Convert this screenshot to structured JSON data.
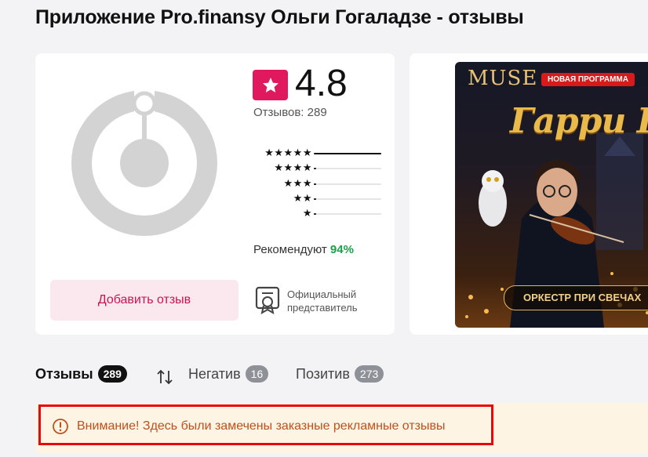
{
  "page": {
    "title": "Приложение Pro.finansy Ольги Гогаладзе - отзывы"
  },
  "summary": {
    "rating": "4.8",
    "reviews_label": "Отзывов: 289",
    "star_rows": [
      {
        "stars": "★★★★★",
        "share": 1.0
      },
      {
        "stars": "★★★★",
        "share": 0.03
      },
      {
        "stars": "★★★",
        "share": 0.02
      },
      {
        "stars": "★★",
        "share": 0.01
      },
      {
        "stars": "★",
        "share": 0.02
      }
    ],
    "recommend_label": "Рекомендуют",
    "recommend_pct": "94%",
    "add_review_button": "Добавить отзыв",
    "official_line1": "Официальный",
    "official_line2": "представитель",
    "accent_color": "#e0185e"
  },
  "ad": {
    "brand": "MUSE",
    "badge": "НОВАЯ ПРОГРАММА",
    "show_title": "Гарри Поттер",
    "cta": "ОРКЕСТР ПРИ СВЕЧАХ"
  },
  "tabs": {
    "reviews_label": "Отзывы",
    "reviews_count": "289",
    "negative_label": "Негатив",
    "negative_count": "16",
    "positive_label": "Позитив",
    "positive_count": "273"
  },
  "alert": {
    "text": "Внимание! Здесь были замечены заказные рекламные отзывы"
  }
}
